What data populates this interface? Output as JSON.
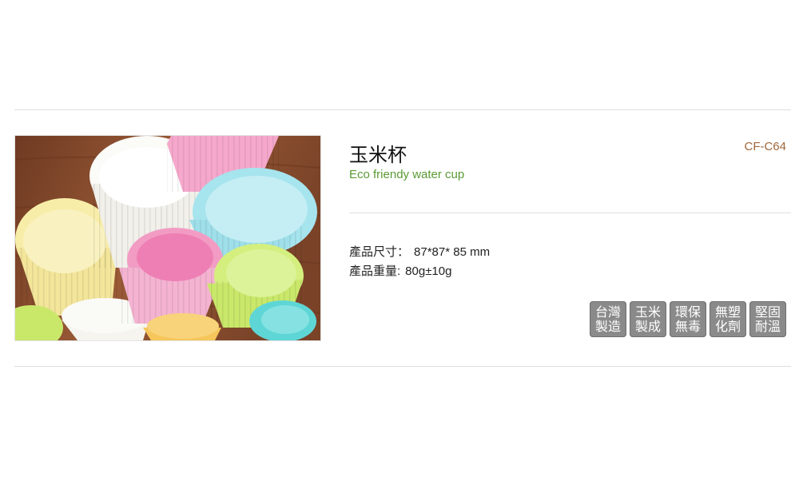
{
  "product": {
    "title": "玉米杯",
    "subtitle": "Eco friendy water cup",
    "code": "CF-C64",
    "specs": [
      {
        "label": "產品尺寸：",
        "value": "87*87* 85 mm"
      },
      {
        "label": "產品重量:",
        "value": "80g±10g"
      }
    ]
  },
  "badges": [
    {
      "line1": "台灣",
      "line2": "製造"
    },
    {
      "line1": "玉米",
      "line2": "製成"
    },
    {
      "line1": "環保",
      "line2": "無毒"
    },
    {
      "line1": "無塑",
      "line2": "化劑"
    },
    {
      "line1": "堅固",
      "line2": "耐溫"
    }
  ],
  "photo": {
    "icon": "pastel-cups-photo",
    "colors": {
      "wood": "#8a4a2c",
      "yellow": "#f3e59a",
      "white": "#f5f4ef",
      "pink": "#f29cc4",
      "blue": "#9fdfea",
      "green": "#c9e86a",
      "orange": "#f6c65a",
      "teal": "#5fd6d6"
    }
  }
}
